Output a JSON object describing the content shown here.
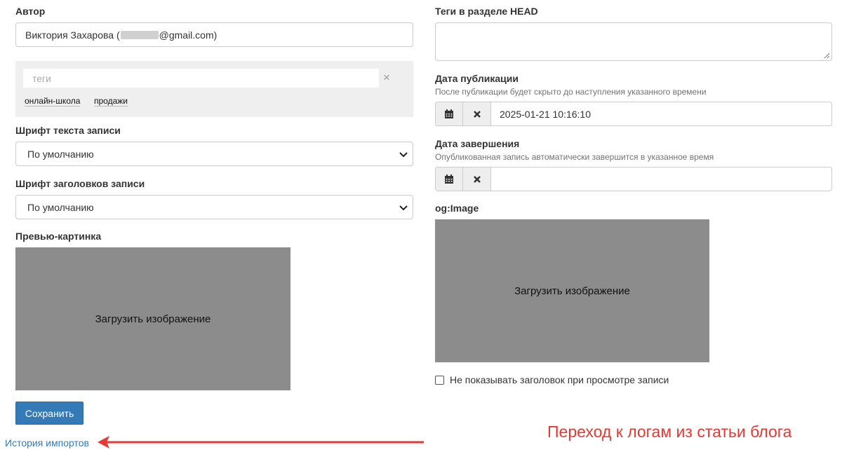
{
  "author": {
    "label": "Автор",
    "name": "Виктория Захарова (",
    "email_suffix": "@gmail.com)"
  },
  "tags": {
    "placeholder": "теги",
    "clear_symbol": "×",
    "items": [
      "онлайн-школа",
      "продажи"
    ]
  },
  "text_font": {
    "label": "Шрифт текста записи",
    "value": "По умолчанию"
  },
  "heading_font": {
    "label": "Шрифт заголовков записи",
    "value": "По умолчанию"
  },
  "preview": {
    "label": "Превью-картинка",
    "upload_text": "Загрузить изображение"
  },
  "save_button": "Сохранить",
  "import_history_link": "История импортов",
  "head_tags": {
    "label": "Теги в разделе HEAD",
    "value": ""
  },
  "publish_date": {
    "label": "Дата публикации",
    "hint": "После публикации будет скрыто до наступления указанного времени",
    "value": "2025-01-21 10:16:10"
  },
  "end_date": {
    "label": "Дата завершения",
    "hint": "Опубликованная запись автоматически завершится в указанное время",
    "value": ""
  },
  "og_image": {
    "label": "og:Image",
    "upload_text": "Загрузить изображение"
  },
  "hide_title_checkbox": {
    "label": "Не показывать заголовок при просмотре записи",
    "checked": false
  },
  "annotation": {
    "text": "Переход к логам из статьи блога",
    "color": "#e53935"
  },
  "colors": {
    "primary_button": "#337ab7",
    "link": "#337ab7",
    "upload_bg": "#8c8c8c"
  }
}
